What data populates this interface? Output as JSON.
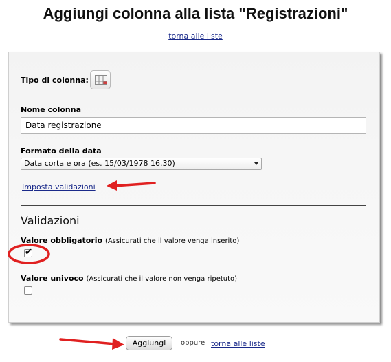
{
  "page": {
    "title": "Aggiungi colonna alla lista \"Registrazioni\"",
    "back_link_top": "torna alle liste"
  },
  "form": {
    "column_type_label": "Tipo di colonna:",
    "column_type_icon": "table-icon",
    "column_name_label": "Nome colonna",
    "column_name_value": "Data registrazione",
    "date_format_label": "Formato della data",
    "date_format_selected": "Data corta e ora (es. 15/03/1978 16.30)",
    "set_validations_link": "Imposta validazioni"
  },
  "validations": {
    "title": "Validazioni",
    "required": {
      "label": "Valore obbligatorio",
      "hint": "(Assicurati che il valore venga inserito)",
      "checked": true
    },
    "unique": {
      "label": "Valore univoco",
      "hint": "(Assicurati che il valore non venga ripetuto)",
      "checked": false
    }
  },
  "footer": {
    "add_button": "Aggiungi",
    "or_text": "oppure",
    "back_link": "torna alle liste"
  },
  "colors": {
    "link": "#1a2a8a",
    "annotation_red": "#e02020"
  }
}
